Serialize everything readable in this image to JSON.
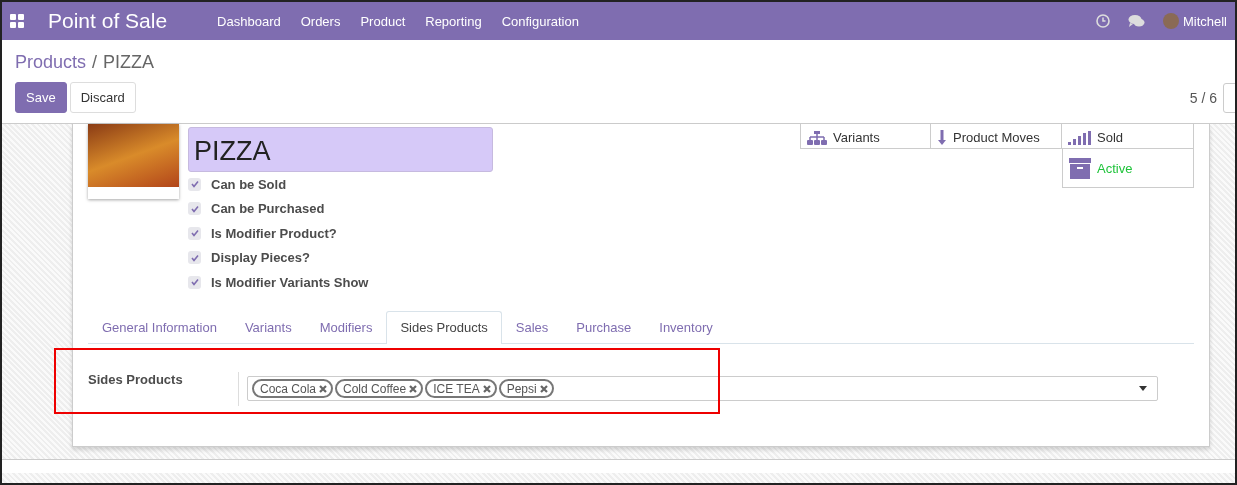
{
  "navbar": {
    "app_title": "Point of Sale",
    "menu": [
      "Dashboard",
      "Orders",
      "Product",
      "Reporting",
      "Configuration"
    ],
    "user": "Mitchell"
  },
  "breadcrumb": {
    "parent": "Products",
    "separator": "/",
    "current": "PIZZA"
  },
  "buttons": [
    {
      "label": "Save",
      "kind": "primary"
    },
    {
      "label": "Discard",
      "kind": "secondary"
    }
  ],
  "pager": "5 / 6",
  "product": {
    "name": "PIZZA",
    "flags": [
      {
        "label": "Can be Sold",
        "checked": true
      },
      {
        "label": "Can be Purchased",
        "checked": true
      },
      {
        "label": "Is Modifier Product?",
        "checked": true
      },
      {
        "label": "Display Pieces?",
        "checked": true
      },
      {
        "label": "Is Modifier Variants Show",
        "checked": true
      }
    ]
  },
  "stat_buttons": [
    {
      "kind": "variants",
      "label": "Variants"
    },
    {
      "kind": "moves",
      "label": "Product Moves"
    },
    {
      "kind": "sold",
      "label": "Sold"
    },
    {
      "kind": "archive",
      "label": "Active"
    }
  ],
  "tabs": [
    {
      "label": "General Information",
      "selected": false
    },
    {
      "label": "Variants",
      "selected": false
    },
    {
      "label": "Modifiers",
      "selected": false
    },
    {
      "label": "Sides Products",
      "selected": true
    },
    {
      "label": "Sales",
      "selected": false
    },
    {
      "label": "Purchase",
      "selected": false
    },
    {
      "label": "Inventory",
      "selected": false
    }
  ],
  "sides_products": {
    "label": "Sides Products",
    "tags": [
      "Coca Cola",
      "Cold Coffee",
      "ICE TEA",
      "Pepsi"
    ]
  }
}
